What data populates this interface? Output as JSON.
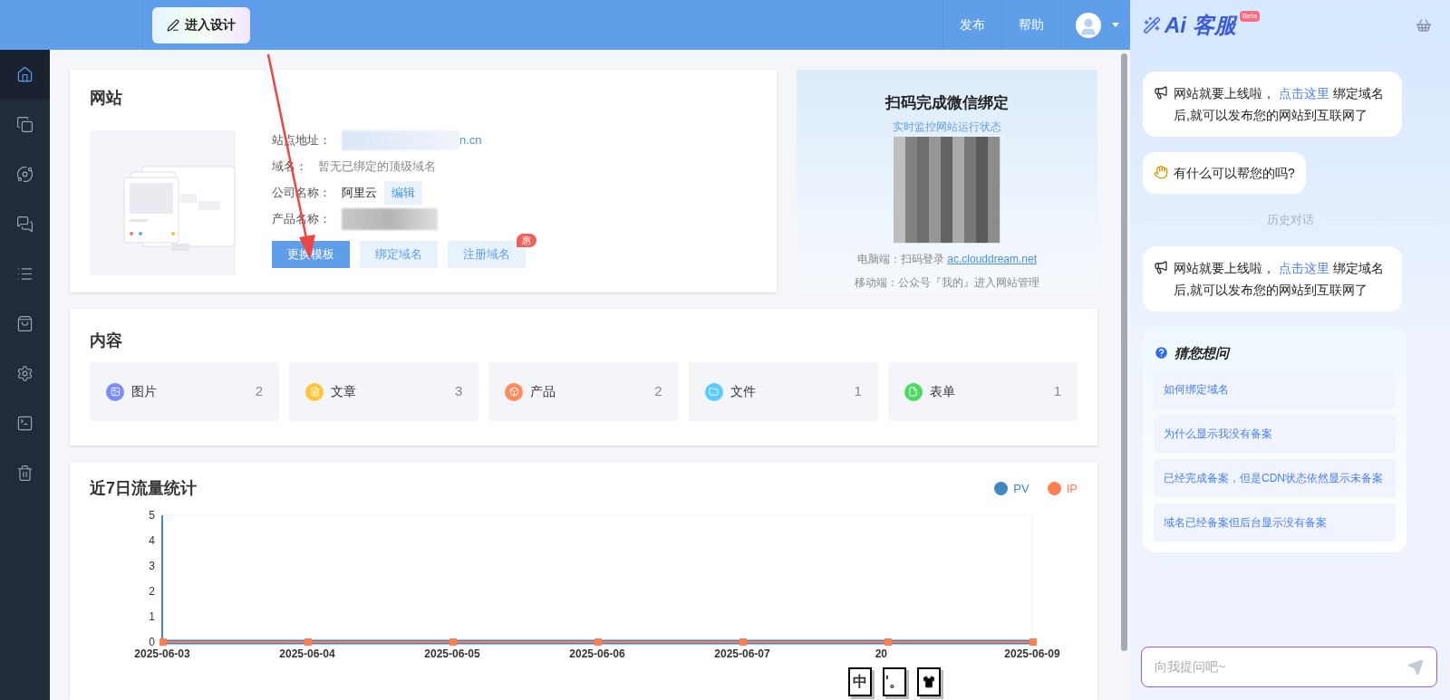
{
  "header": {
    "design_button": "进入设计",
    "nav": [
      "发布",
      "帮助"
    ]
  },
  "sidebar": {
    "items": [
      {
        "selected": true
      },
      {
        "selected": false
      },
      {
        "selected": false
      },
      {
        "selected": false
      },
      {
        "selected": false
      },
      {
        "selected": false
      },
      {
        "selected": false
      },
      {
        "selected": false
      },
      {
        "selected": false
      }
    ]
  },
  "website": {
    "title": "网站",
    "fields": [
      {
        "kind": "link",
        "label": "站点地址：",
        "value": "n.cn"
      },
      {
        "kind": "text",
        "label": "域名：",
        "value": "暂无已绑定的顶级域名"
      },
      {
        "kind": "edit",
        "label": "公司名称：",
        "value": "阿里云",
        "action": "编辑"
      },
      {
        "kind": "blurred",
        "label": "产品名称："
      }
    ],
    "buttons": [
      {
        "label": "更换模板",
        "primary": true
      },
      {
        "label": "绑定域名",
        "primary": false
      },
      {
        "label": "注册域名",
        "primary": false,
        "badge": "惠"
      }
    ]
  },
  "wechat": {
    "title": "扫码完成微信绑定",
    "subtitle": "实时监控网站运行状态",
    "lines": [
      {
        "label": "电脑端：扫码登录 ",
        "link": "ac.clouddream.net"
      },
      {
        "label": "移动端：公众号『我的』进入网站管理"
      }
    ]
  },
  "content": {
    "title": "内容",
    "items": [
      {
        "label": "图片",
        "count": "2",
        "color": "#7b8cff"
      },
      {
        "label": "文章",
        "count": "3",
        "color": "#ffc53d"
      },
      {
        "label": "产品",
        "count": "2",
        "color": "#ff8a5b"
      },
      {
        "label": "文件",
        "count": "1",
        "color": "#5ccbff"
      },
      {
        "label": "表单",
        "count": "1",
        "color": "#4cd964"
      }
    ]
  },
  "traffic": {
    "title": "近7日流量统计",
    "chart_data": {
      "type": "line",
      "categories": [
        "2025-06-03",
        "2025-06-04",
        "2025-06-05",
        "2025-06-06",
        "2025-06-07",
        "20",
        "2025-06-09"
      ],
      "series": [
        {
          "name": "PV",
          "color": "#3f88c5",
          "marker": "none",
          "values": [
            0,
            0,
            0,
            0,
            0,
            0,
            0
          ]
        },
        {
          "name": "IP",
          "color": "#ff7f50",
          "marker": "square",
          "values": [
            0,
            0,
            0,
            0,
            0,
            0,
            0
          ]
        }
      ],
      "ylim": [
        0,
        5
      ],
      "yticks": [
        0,
        1,
        2,
        3,
        4,
        5
      ]
    }
  },
  "ime_toolbar": [
    "中",
    "'。"
  ],
  "chat": {
    "title": "客服",
    "title_prefix": "Ai",
    "beta": "Beta",
    "messages": [
      {
        "kind": "announce",
        "before": "网站就要上线啦，",
        "link": "点击这里",
        "after": " 绑定域名后,就可以发布您的网站到互联网了"
      },
      {
        "kind": "wave",
        "text": "有什么可以帮您的吗?"
      },
      {
        "kind": "divider",
        "text": "历史对话"
      },
      {
        "kind": "announce",
        "before": "网站就要上线啦，",
        "link": "点击这里",
        "after": " 绑定域名后,就可以发布您的网站到互联网了"
      }
    ],
    "suggest_title": "猜您想问",
    "suggestions": [
      "如何绑定域名",
      "为什么显示我没有备案",
      "已经完成备案，但是CDN状态依然显示未备案",
      "域名已经备案但后台显示没有备案"
    ],
    "input": {
      "placeholder": "向我提问吧~"
    }
  }
}
